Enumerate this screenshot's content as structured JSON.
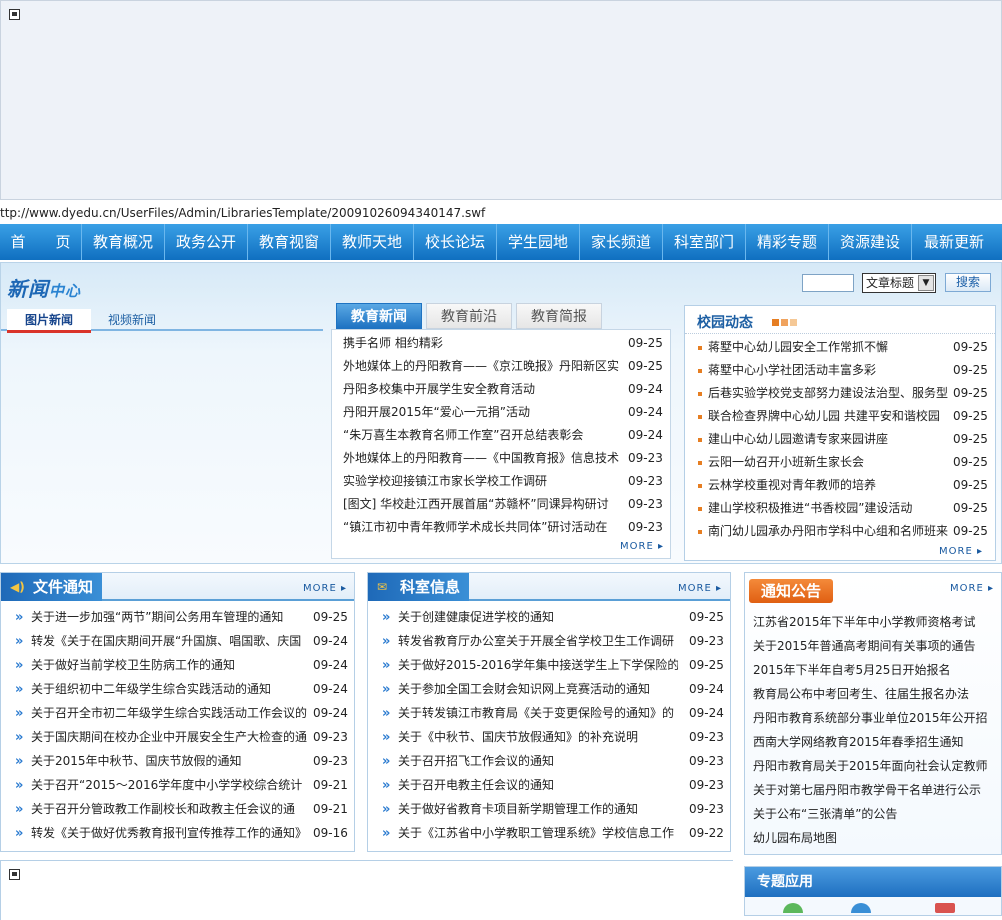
{
  "flash_url": "ttp://www.dyedu.cn/UserFiles/Admin/LibrariesTemplate/20091026094340147.swf",
  "nav": [
    "首　　页",
    "教育概况",
    "政务公开",
    "教育视窗",
    "教师天地",
    "校长论坛",
    "学生园地",
    "家长频道",
    "科室部门",
    "精彩专题",
    "资源建设",
    "最新更新"
  ],
  "news_center": {
    "title_main": "新闻",
    "title_sub": "中心",
    "search_select": "文章标题",
    "search_button": "搜索",
    "pic_tabs": [
      "图片新闻",
      "视频新闻"
    ],
    "edu_tabs": [
      "教育新闻",
      "教育前沿",
      "教育简报"
    ],
    "edu_news": [
      {
        "title": "携手名师 相约精彩",
        "date": "09-25"
      },
      {
        "title": "外地媒体上的丹阳教育——《京江晚报》丹阳新区实",
        "date": "09-25"
      },
      {
        "title": "丹阳多校集中开展学生安全教育活动",
        "date": "09-24"
      },
      {
        "title": "丹阳开展2015年“爱心一元捐”活动",
        "date": "09-24"
      },
      {
        "title": "“朱万喜生本教育名师工作室”召开总结表彰会",
        "date": "09-24"
      },
      {
        "title": "外地媒体上的丹阳教育——《中国教育报》信息技术",
        "date": "09-23"
      },
      {
        "title": "实验学校迎接镇江市家长学校工作调研",
        "date": "09-23"
      },
      {
        "title": "[图文] 华校赴江西开展首届“苏赣杯”同课异构研讨",
        "date": "09-23"
      },
      {
        "title": "“镇江市初中青年教师学术成长共同体”研讨活动在",
        "date": "09-23"
      }
    ],
    "more": "MORE",
    "campus_title": "校园动态",
    "campus_news": [
      {
        "title": "蒋墅中心幼儿园安全工作常抓不懈",
        "date": "09-25"
      },
      {
        "title": "蒋墅中心小学社团活动丰富多彩",
        "date": "09-25"
      },
      {
        "title": "后巷实验学校党支部努力建设法治型、服务型",
        "date": "09-25"
      },
      {
        "title": "联合检查界牌中心幼儿园 共建平安和谐校园",
        "date": "09-25"
      },
      {
        "title": "建山中心幼儿园邀请专家来园讲座",
        "date": "09-25"
      },
      {
        "title": "云阳一幼召开小班新生家长会",
        "date": "09-25"
      },
      {
        "title": "云林学校重视对青年教师的培养",
        "date": "09-25"
      },
      {
        "title": "建山学校积极推进“书香校园”建设活动",
        "date": "09-25"
      },
      {
        "title": "南门幼儿园承办丹阳市学科中心组和名师班来",
        "date": "09-25"
      }
    ]
  },
  "file_notice": {
    "title": "文件通知",
    "more": "MORE",
    "items": [
      {
        "title": "关于进一步加强“两节”期间公务用车管理的通知",
        "date": "09-25"
      },
      {
        "title": "转发《关于在国庆期间开展“升国旗、唱国歌、庆国",
        "date": "09-24"
      },
      {
        "title": "关于做好当前学校卫生防病工作的通知",
        "date": "09-24"
      },
      {
        "title": "关于组织初中二年级学生综合实践活动的通知",
        "date": "09-24"
      },
      {
        "title": "关于召开全市初二年级学生综合实践活动工作会议的",
        "date": "09-24"
      },
      {
        "title": "关于国庆期间在校办企业中开展安全生产大检查的通",
        "date": "09-23"
      },
      {
        "title": "关于2015年中秋节、国庆节放假的通知",
        "date": "09-23"
      },
      {
        "title": "关于召开“2015～2016学年度中小学学校综合统计",
        "date": "09-21"
      },
      {
        "title": "关于召开分管政教工作副校长和政教主任会议的通",
        "date": "09-21"
      },
      {
        "title": "转发《关于做好优秀教育报刊宣传推荐工作的通知》",
        "date": "09-16"
      }
    ]
  },
  "office_info": {
    "title": "科室信息",
    "more": "MORE",
    "items": [
      {
        "title": "关于创建健康促进学校的通知",
        "date": "09-25"
      },
      {
        "title": "转发省教育厅办公室关于开展全省学校卫生工作调研",
        "date": "09-23"
      },
      {
        "title": "关于做好2015-2016学年集中接送学生上下学保险的",
        "date": "09-25"
      },
      {
        "title": "关于参加全国工会财会知识网上竞赛活动的通知",
        "date": "09-24"
      },
      {
        "title": "关于转发镇江市教育局《关于变更保险号的通知》的",
        "date": "09-24"
      },
      {
        "title": "关于《中秋节、国庆节放假通知》的补充说明",
        "date": "09-23"
      },
      {
        "title": "关于召开招飞工作会议的通知",
        "date": "09-23"
      },
      {
        "title": "关于召开电教主任会议的通知",
        "date": "09-23"
      },
      {
        "title": "关于做好省教育卡项目新学期管理工作的通知",
        "date": "09-23"
      },
      {
        "title": "关于《江苏省中小学教职工管理系统》学校信息工作",
        "date": "09-22"
      }
    ]
  },
  "announcement": {
    "title": "通知公告",
    "more": "MORE",
    "items": [
      "江苏省2015年下半年中小学教师资格考试",
      "关于2015年普通高考期间有关事项的通告",
      "2015年下半年自考5月25日开始报名",
      "教育局公布中考回考生、往届生报名办法",
      "丹阳市教育系统部分事业单位2015年公开招",
      "西南大学网络教育2015年春季招生通知",
      "丹阳市教育局关于2015年面向社会认定教师",
      "关于对第七届丹阳市教学骨干名单进行公示",
      "关于公布“三张清单”的公告",
      "幼儿园布局地图"
    ]
  },
  "special": {
    "title": "专题应用"
  },
  "colors": {
    "nav_top": "#3aa0e6",
    "nav_bottom": "#0f6fc0",
    "accent_orange": "#e05f12",
    "link_blue": "#1d5fa3"
  }
}
